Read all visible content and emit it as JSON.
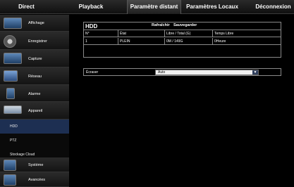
{
  "tabs": [
    {
      "label": "Direct"
    },
    {
      "label": "Playback"
    },
    {
      "label": "Paramètre distant"
    },
    {
      "label": "Paramètres Locaux"
    },
    {
      "label": "Déconnexion"
    }
  ],
  "active_tab": "Paramètre distant",
  "sidebar": {
    "items": [
      {
        "label": "Affichage",
        "icon": "monitor-icon"
      },
      {
        "label": "Enregistrer",
        "icon": "film-reel-icon"
      },
      {
        "label": "Capture",
        "icon": "camera-capture-icon"
      },
      {
        "label": "Réseau",
        "icon": "network-icon"
      },
      {
        "label": "Alarme",
        "icon": "alarm-icon"
      },
      {
        "label": "Appareil",
        "icon": "device-icon"
      },
      {
        "label": "Système",
        "icon": "system-icon"
      },
      {
        "label": "Avancées",
        "icon": "advanced-icon"
      }
    ],
    "subitems": [
      {
        "label": "HDD"
      },
      {
        "label": "PTZ"
      },
      {
        "label": "Stockage Cloud"
      }
    ],
    "active_subitem": "HDD"
  },
  "hdd": {
    "title": "HDD",
    "refresh_label": "Rafraîchir",
    "save_label": "Sauvegarder",
    "columns": [
      "N°",
      "État",
      "Libre / Total (G)",
      "Temps Libre"
    ],
    "rows": [
      [
        "1",
        "PLEIN",
        "0M / 149G",
        "0Heure"
      ]
    ]
  },
  "overwrite": {
    "label": "Écraser",
    "value": "Auto"
  }
}
